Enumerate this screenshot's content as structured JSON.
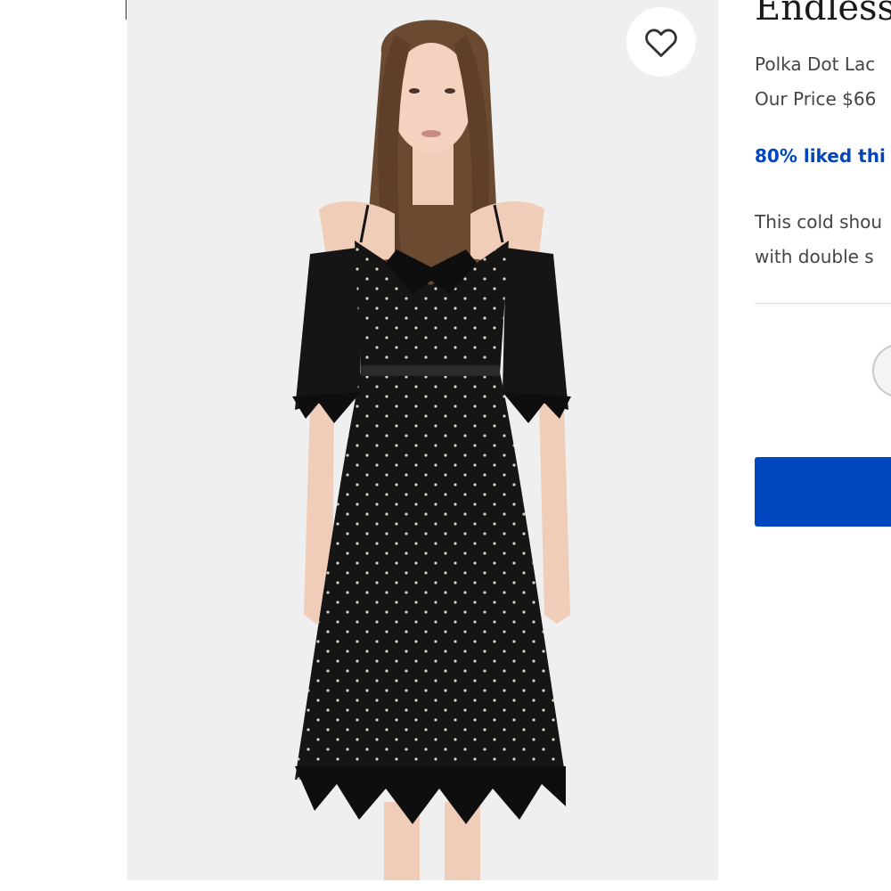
{
  "product": {
    "title": "Endless",
    "subtitle": "Polka Dot Lac",
    "price": "Our Price $66",
    "rating_text": "80% liked thi",
    "description_lines": [
      "This cold shou",
      "with double s"
    ]
  },
  "gallery": {
    "image_alt": "Model wearing a black polka dot lace cold-shoulder midi dress",
    "favorite_icon": "heart-outline-icon"
  },
  "colors": {
    "accent": "#0046be",
    "text": "#444444",
    "photo_bg": "#efefef",
    "dress": "#151515"
  }
}
